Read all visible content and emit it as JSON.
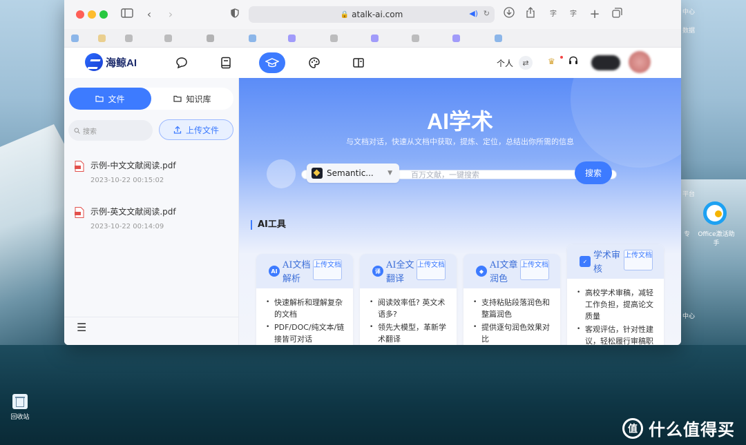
{
  "browser": {
    "url": "atalk-ai.com"
  },
  "header": {
    "logo_text": "海鲸AI",
    "personal_label": "个人"
  },
  "sidebar": {
    "tabs": [
      {
        "label": "文件",
        "active": true
      },
      {
        "label": "知识库",
        "active": false
      }
    ],
    "search_placeholder": "搜索",
    "upload_label": "上传文件",
    "files": [
      {
        "name": "示例-中文文献阅读.pdf",
        "date": "2023-10-22 00:15:02"
      },
      {
        "name": "示例-英文文献阅读.pdf",
        "date": "2023-10-22 00:14:09"
      }
    ]
  },
  "main": {
    "title": "AI学术",
    "subtitle": "与文档对话，快速从文档中获取，提炼、定位，总结出你所需的信息",
    "search": {
      "source": "Semantic...",
      "placeholder": "百万文献，一键搜索",
      "button": "搜索"
    },
    "section_title": "AI工具",
    "cards": [
      {
        "title": "AI文档解析",
        "upload": "上传文档",
        "icon": "AI",
        "items": [
          "快速解析和理解复杂的文档",
          "PDF/DOC/纯文本/链接皆可对话"
        ]
      },
      {
        "title": "AI全文翻译",
        "upload": "上传文档",
        "icon": "译",
        "items": [
          "阅读效率低? 英文术语多?",
          "领先大模型，革新学术翻译"
        ]
      },
      {
        "title": "AI文章润色",
        "upload": "上传文档",
        "icon": "◆",
        "items": [
          "支持粘贴段落润色和整篇润色",
          "提供逐句润色效果对比"
        ]
      },
      {
        "title": "学术审核",
        "upload": "上传文档",
        "icon": "✓",
        "items": [
          "高校学术审稿，减轻工作负担，提高论文质量",
          "客观评估，针对性建议，轻松履行审稿职"
        ]
      }
    ]
  },
  "desktop": {
    "right_app_label": "Office激活助手",
    "recycle_bin": "回收站",
    "watermark": "什么值得买",
    "watermark_logo": "值",
    "edge_labels": [
      "中心",
      "数据",
      "平台",
      "专",
      "中心"
    ]
  },
  "colors": {
    "accent": "#3d7bff",
    "traffic_red": "#fe5f57",
    "traffic_yellow": "#febc2e",
    "traffic_green": "#28c840"
  }
}
